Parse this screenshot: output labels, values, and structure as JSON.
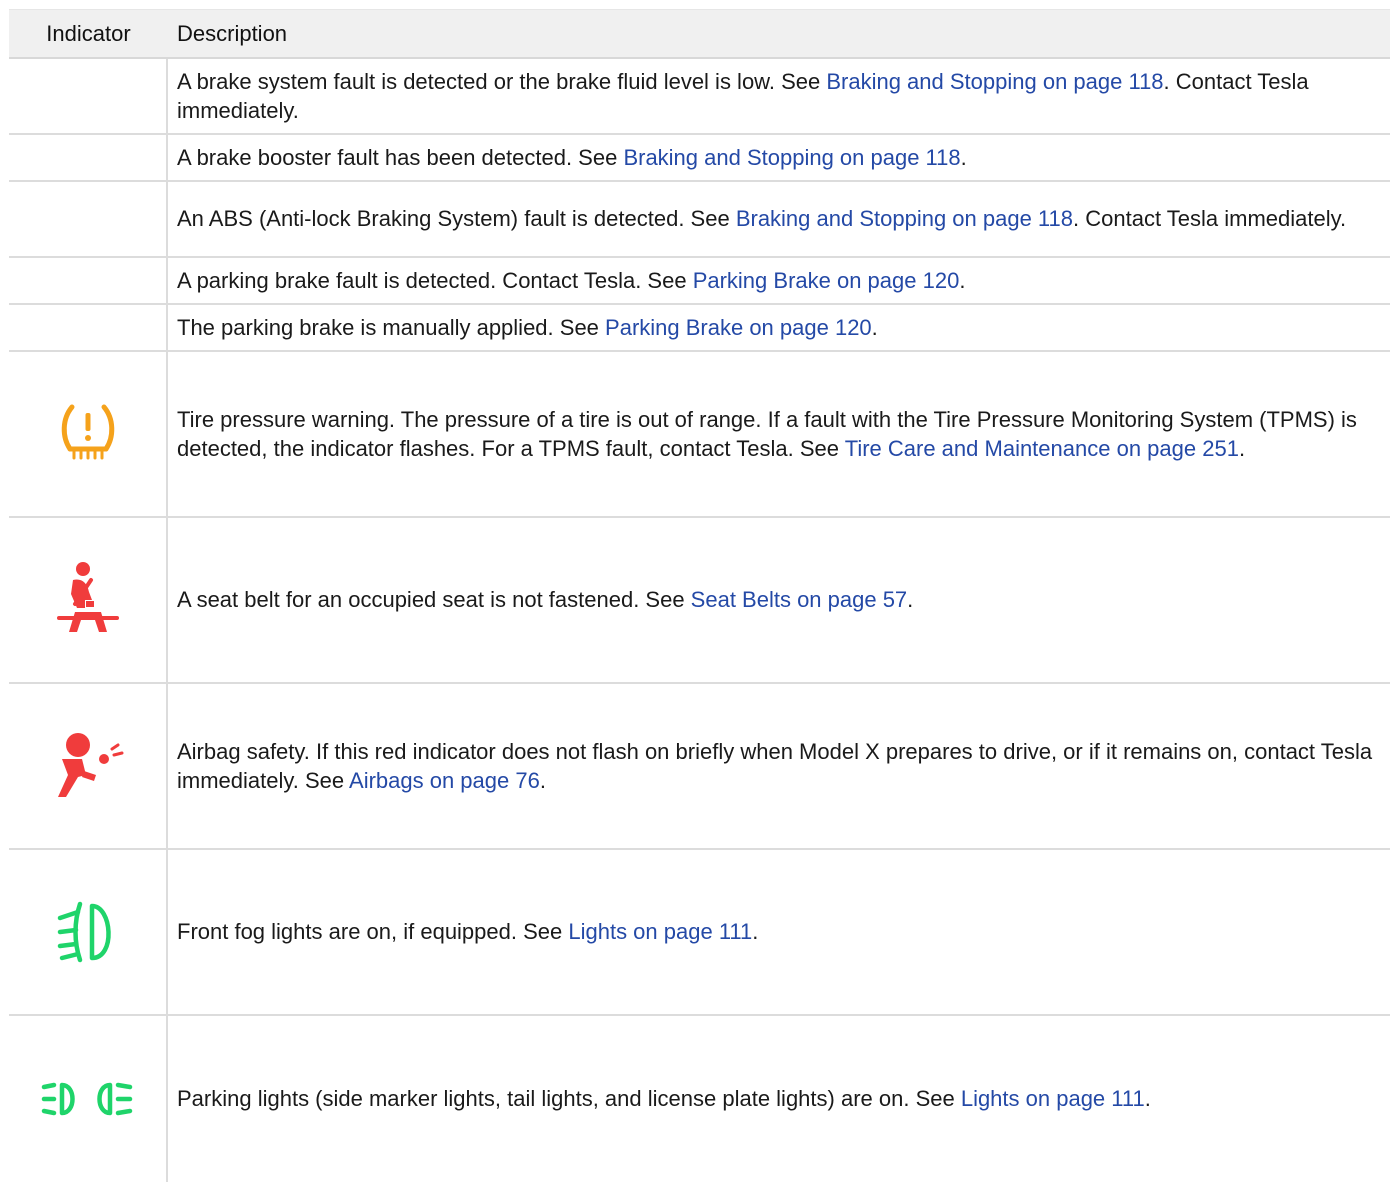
{
  "header": {
    "indicator": "Indicator",
    "description": "Description"
  },
  "rows": [
    {
      "icon": "",
      "text_before": "A brake system fault is detected or the brake fluid level is low. See ",
      "link": "Braking and Stopping on page 118",
      "text_after": ". Contact Tesla immediately."
    },
    {
      "icon": "",
      "text_before": "A brake booster fault has been detected. See ",
      "link": "Braking and Stopping on page 118",
      "text_after": "."
    },
    {
      "icon": "",
      "text_before": "An ABS (Anti-lock Braking System) fault is detected. See ",
      "link": "Braking and Stopping on page 118",
      "text_after": ". Contact Tesla immediately."
    },
    {
      "icon": "",
      "text_before": "A parking brake fault is detected. Contact Tesla. See ",
      "link": "Parking Brake on page 120",
      "text_after": "."
    },
    {
      "icon": "",
      "text_before": "The parking brake is manually applied. See ",
      "link": "Parking Brake on page 120",
      "text_after": "."
    },
    {
      "icon": "tire-pressure-warning-icon",
      "text_before": "Tire pressure warning. The pressure of a tire is out of range. If a fault with the Tire Pressure Monitoring System (TPMS) is detected, the indicator flashes. For a TPMS fault, contact Tesla. See ",
      "link": "Tire Care and Maintenance on page 251",
      "text_after": "."
    },
    {
      "icon": "seat-belt-warning-icon",
      "text_before": "A seat belt for an occupied seat is not fastened. See ",
      "link": "Seat Belts on page 57",
      "text_after": "."
    },
    {
      "icon": "airbag-safety-icon",
      "text_before": "Airbag safety. If this red indicator does not flash on briefly when Model X prepares to drive, or if it remains on, contact Tesla immediately. See ",
      "link": "Airbags on page 76",
      "text_after": "."
    },
    {
      "icon": "front-fog-lights-icon",
      "text_before": "Front fog lights are on, if equipped. See ",
      "link": "Lights on page 111",
      "text_after": "."
    },
    {
      "icon": "parking-lights-icon",
      "text_before": "Parking lights (side marker lights, tail lights, and license plate lights) are on. See ",
      "link": "Lights on page 111",
      "text_after": "."
    }
  ],
  "colors": {
    "link": "#2449a6",
    "tire_icon": "#f5a21b",
    "seatbelt_icon": "#f03c3c",
    "airbag_icon": "#f03c3c",
    "fog_icon": "#1fd46a",
    "parking_icon": "#1fd46a",
    "header_bg": "#f0f0f0",
    "grid": "#dcdcdc"
  }
}
